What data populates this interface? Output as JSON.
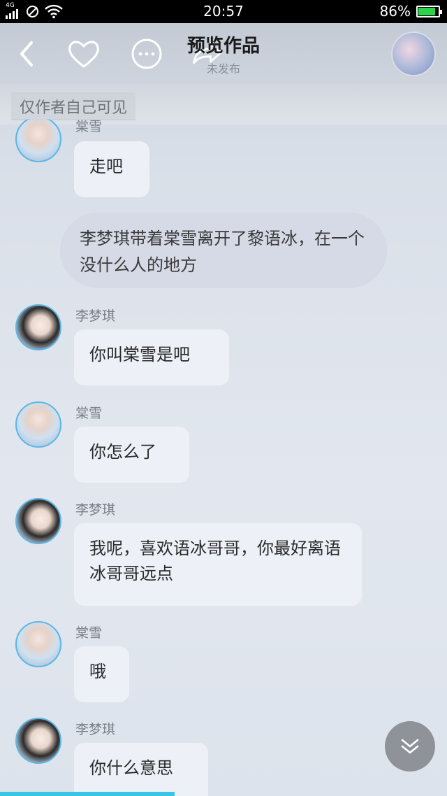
{
  "status_bar": {
    "network": "4G",
    "time": "20:57",
    "battery_text": "86%",
    "battery_level": 0.86,
    "battery_color": "#2bd44a"
  },
  "header": {
    "title": "预览作品",
    "subtitle": "未发布",
    "icons": [
      "back-icon",
      "heart-icon",
      "more-icon",
      "share-icon"
    ]
  },
  "notice": {
    "text": "仅作者自己可见"
  },
  "messages": [
    {
      "name": "棠雪",
      "text": "走吧"
    },
    {
      "narration": "李梦琪带着棠雪离开了黎语冰，在一个没什么人的地方"
    },
    {
      "name": "李梦琪",
      "text": "你叫棠雪是吧"
    },
    {
      "name": "棠雪",
      "text": "你怎么了"
    },
    {
      "name": "李梦琪",
      "text": "我呢，喜欢语冰哥哥，你最好离语冰哥哥远点"
    },
    {
      "name": "棠雪",
      "text": "哦"
    },
    {
      "name": "李梦琪",
      "text": "你什么意思"
    }
  ],
  "colors": {
    "accent": "#37c6e6",
    "avatar_ring": "#5bb7e6",
    "bubble": "#edf1f7",
    "narration_bubble": "#d6d9e6"
  },
  "reading_progress": 0.39
}
